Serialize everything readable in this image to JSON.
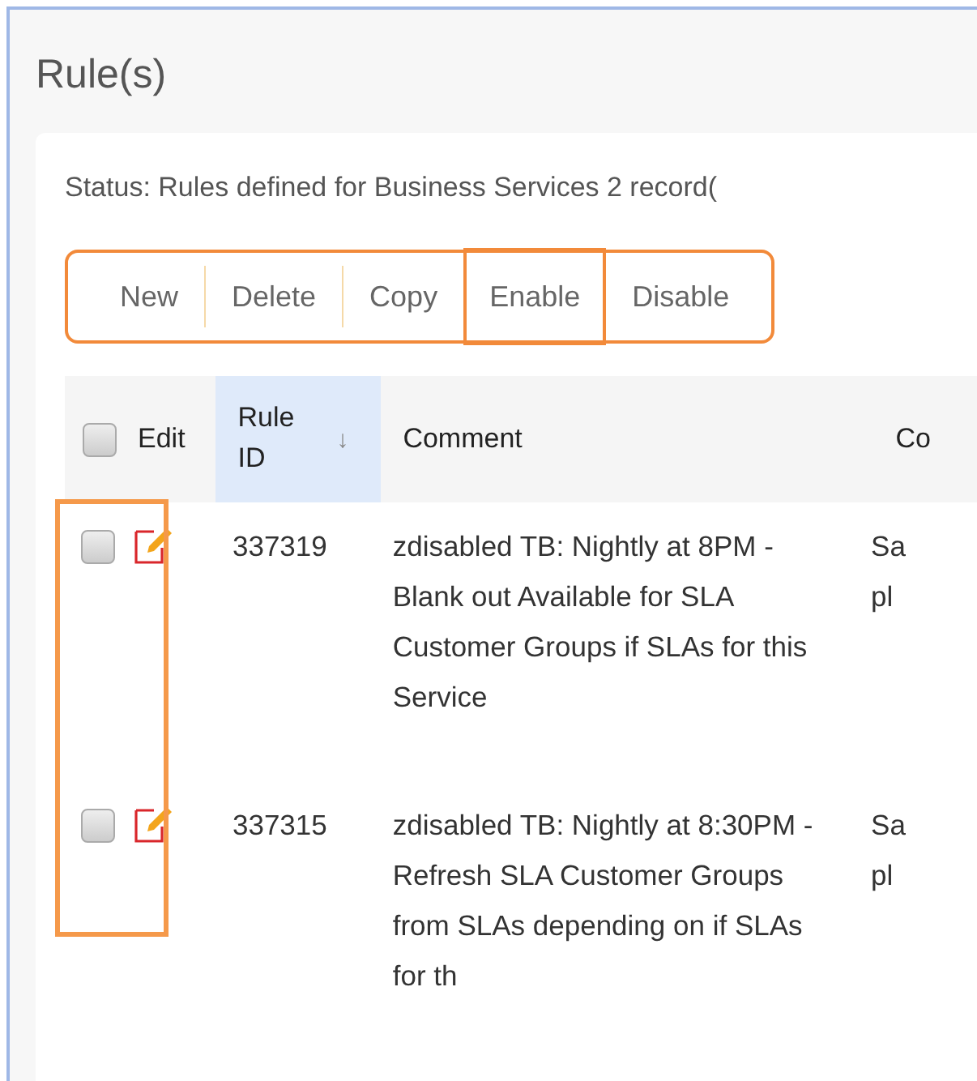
{
  "title": "Rule(s)",
  "status": "Status: Rules defined for Business Services 2 record(",
  "toolbar": [
    {
      "label": "New",
      "highlighted": false
    },
    {
      "label": "Delete",
      "highlighted": false
    },
    {
      "label": "Copy",
      "highlighted": false
    },
    {
      "label": "Enable",
      "highlighted": true
    },
    {
      "label": "Disable",
      "highlighted": false
    }
  ],
  "table": {
    "select_all_checked": false,
    "checkbox_column_highlighted": true,
    "columns": [
      {
        "label": "Edit",
        "sorted": false
      },
      {
        "label": "Rule ID",
        "sorted": true,
        "sort_icon": "↓"
      },
      {
        "label": "Comment",
        "sorted": false
      },
      {
        "label": "Co",
        "sorted": false
      }
    ],
    "rows": [
      {
        "checked": false,
        "rule_id": "337319",
        "comment": "zdisabled TB: Nightly at 8PM - Blank out Available for SLA Customer Groups if SLAs for this Service",
        "column_4": [
          "Sa",
          "pl"
        ]
      },
      {
        "checked": false,
        "rule_id": "337315",
        "comment": "zdisabled TB: Nightly at 8:30PM - Refresh SLA Customer Groups from SLAs depending on if SLAs for th",
        "column_4": [
          "Sa",
          "pl"
        ]
      }
    ]
  }
}
